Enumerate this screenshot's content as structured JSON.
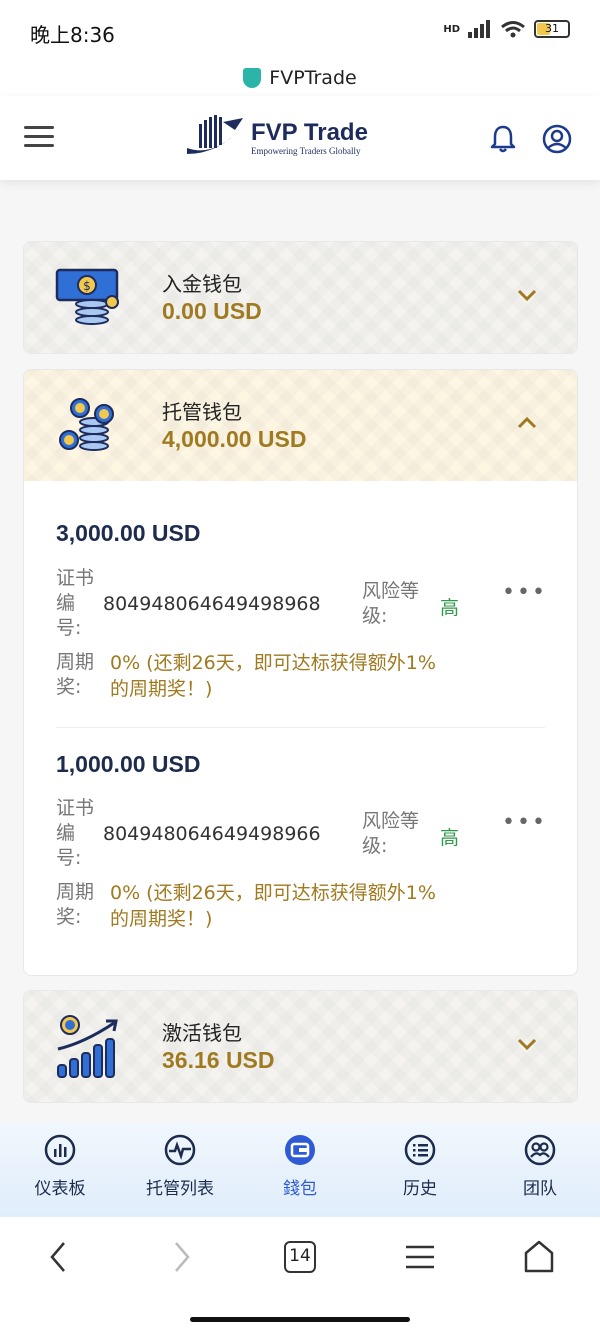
{
  "status": {
    "time": "晚上8:36",
    "network": "HD",
    "battery": "31"
  },
  "browser": {
    "url_title": "FVPTrade",
    "tab_count": "14"
  },
  "header": {
    "logo_title": "FVP Trade",
    "logo_tagline": "Empowering Traders Globally"
  },
  "wallets": [
    {
      "name": "入金钱包",
      "amount": "0.00 USD",
      "expanded": false
    },
    {
      "name": "托管钱包",
      "amount": "4,000.00 USD",
      "expanded": true,
      "deposits": [
        {
          "amount": "3,000.00 USD",
          "cert_label": "证书编号:",
          "cert_no": "804948064649498968",
          "risk_label": "风险等级:",
          "risk_value": "高",
          "bonus_label": "周期奖:",
          "bonus_text": "0% (还剩26天，即可达标获得额外1%的周期奖！)"
        },
        {
          "amount": "1,000.00 USD",
          "cert_label": "证书编号:",
          "cert_no": "804948064649498966",
          "risk_label": "风险等级:",
          "risk_value": "高",
          "bonus_label": "周期奖:",
          "bonus_text": "0% (还剩26天，即可达标获得额外1%的周期奖！)"
        }
      ]
    },
    {
      "name": "激活钱包",
      "amount": "36.16 USD",
      "expanded": false
    }
  ],
  "tabs": [
    {
      "label": "仪表板",
      "icon": "dashboard-icon"
    },
    {
      "label": "托管列表",
      "icon": "pulse-icon"
    },
    {
      "label": "錢包",
      "icon": "wallet-icon",
      "active": true
    },
    {
      "label": "历史",
      "icon": "list-icon"
    },
    {
      "label": "团队",
      "icon": "team-icon"
    }
  ],
  "colors": {
    "gold": "#a07a20",
    "navy": "#1d2c5c",
    "accent": "#2f5ad6",
    "risk_high": "#2f9a4a"
  }
}
